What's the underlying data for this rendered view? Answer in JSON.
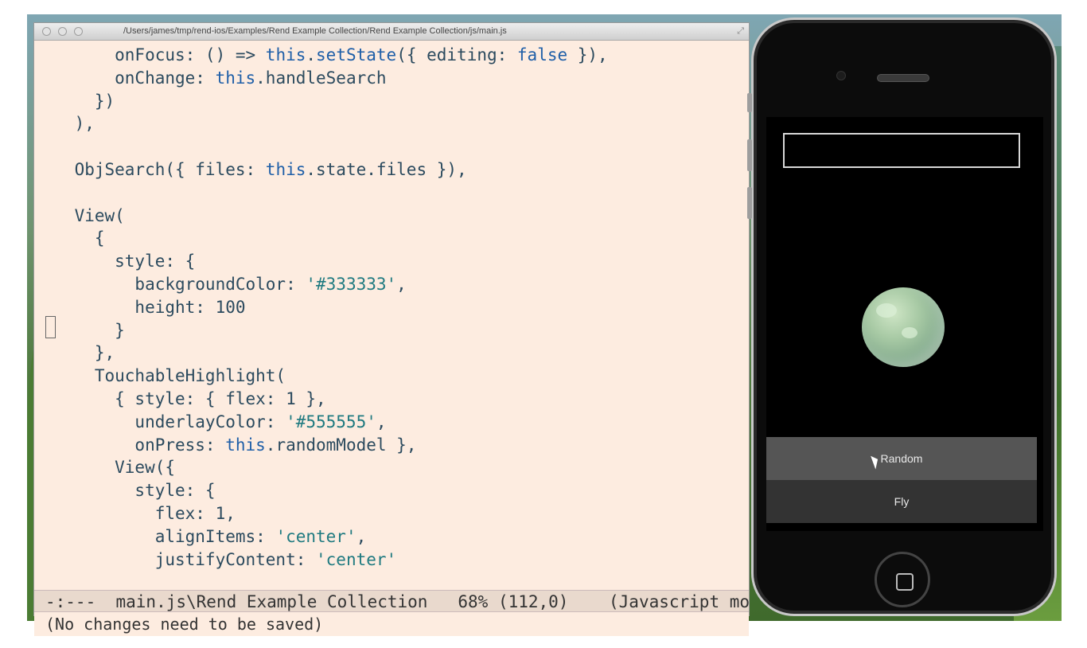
{
  "window": {
    "title": "/Users/james/tmp/rend-ios/Examples/Rend Example Collection/Rend Example Collection/js/main.js"
  },
  "code_lines": [
    {
      "parts": [
        [
          "        onFocus: () => ",
          ""
        ],
        [
          "this",
          "kw"
        ],
        [
          ".",
          ""
        ],
        [
          "setState",
          "kw"
        ],
        [
          "({ editing: ",
          ""
        ],
        [
          "false",
          "kw"
        ],
        [
          " }),",
          ""
        ]
      ]
    },
    {
      "parts": [
        [
          "        onChange: ",
          ""
        ],
        [
          "this",
          "kw"
        ],
        [
          ".handleSearch",
          ""
        ]
      ]
    },
    {
      "parts": [
        [
          "      })",
          ""
        ]
      ]
    },
    {
      "parts": [
        [
          "    ),",
          ""
        ]
      ]
    },
    {
      "parts": [
        [
          "",
          ""
        ]
      ]
    },
    {
      "parts": [
        [
          "    ObjSearch({ files: ",
          ""
        ],
        [
          "this",
          "kw"
        ],
        [
          ".state.files }),",
          ""
        ]
      ]
    },
    {
      "parts": [
        [
          "",
          ""
        ]
      ]
    },
    {
      "parts": [
        [
          "    View(",
          ""
        ]
      ]
    },
    {
      "parts": [
        [
          "      {",
          ""
        ]
      ]
    },
    {
      "parts": [
        [
          "        style: {",
          ""
        ]
      ]
    },
    {
      "parts": [
        [
          "          backgroundColor: ",
          ""
        ],
        [
          "'#333333'",
          "str"
        ],
        [
          ",",
          ""
        ]
      ]
    },
    {
      "parts": [
        [
          "          height: 100",
          ""
        ]
      ]
    },
    {
      "parts": [
        [
          "        }",
          ""
        ]
      ]
    },
    {
      "parts": [
        [
          "      },",
          ""
        ]
      ]
    },
    {
      "parts": [
        [
          "      TouchableHighlight(",
          ""
        ]
      ]
    },
    {
      "parts": [
        [
          "        { style: { flex: 1 },",
          ""
        ]
      ]
    },
    {
      "parts": [
        [
          "          underlayColor: ",
          ""
        ],
        [
          "'#555555'",
          "str"
        ],
        [
          ",",
          ""
        ]
      ]
    },
    {
      "parts": [
        [
          "          onPress: ",
          ""
        ],
        [
          "this",
          "kw"
        ],
        [
          ".randomModel },",
          ""
        ]
      ]
    },
    {
      "parts": [
        [
          "        View({",
          ""
        ]
      ]
    },
    {
      "parts": [
        [
          "          style: {",
          ""
        ]
      ]
    },
    {
      "parts": [
        [
          "            flex: 1,",
          ""
        ]
      ]
    },
    {
      "parts": [
        [
          "            alignItems: ",
          ""
        ],
        [
          "'center'",
          "str"
        ],
        [
          ",",
          ""
        ]
      ]
    },
    {
      "parts": [
        [
          "            justifyContent: ",
          ""
        ],
        [
          "'center'",
          "str"
        ],
        [
          "",
          ""
        ]
      ]
    }
  ],
  "modeline": "-:---  main.js\\Rend Example Collection   68% (112,0)    (Javascript mo",
  "minibuffer": "(No changes need to be saved)",
  "phone": {
    "search_value": "",
    "random_label": "Random",
    "fly_label": "Fly"
  },
  "colors": {
    "editor_bg": "#fdece0",
    "keyword": "#1f5fa8",
    "string": "#1f7a80",
    "random_button_bg": "#555555",
    "fly_button_bg": "#333333"
  }
}
